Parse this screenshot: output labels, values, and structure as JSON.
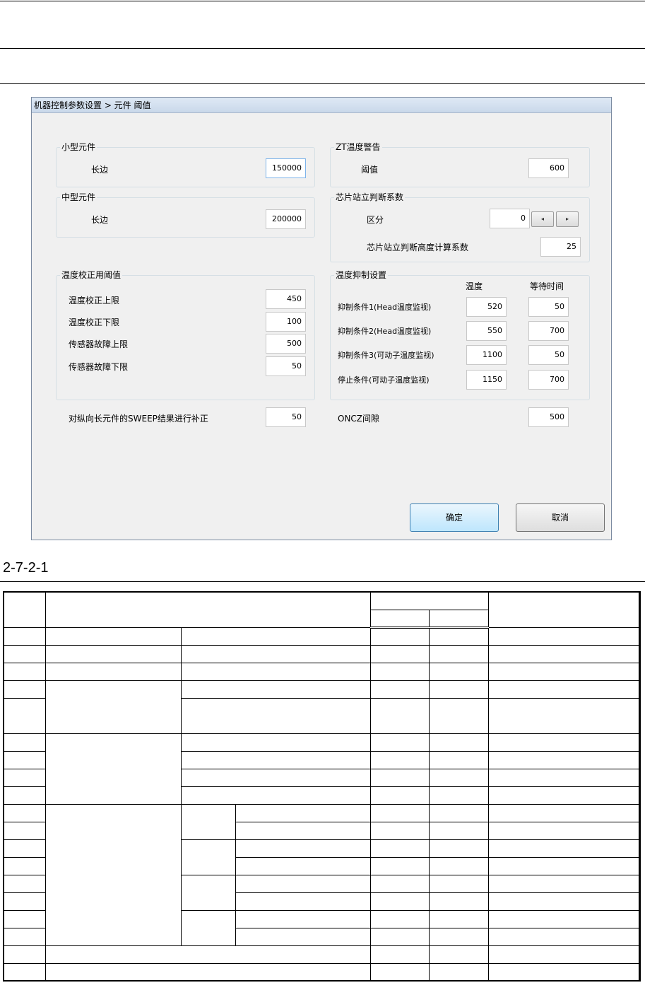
{
  "dialog": {
    "title": "机器控制参数设置 > 元件 阈值",
    "small_component": {
      "title": "小型元件",
      "long_side_label": "长边",
      "long_side_value": "150000"
    },
    "medium_component": {
      "title": "中型元件",
      "long_side_label": "长边",
      "long_side_value": "200000"
    },
    "zt_warning": {
      "title": "ZT温度警告",
      "threshold_label": "阈值",
      "threshold_value": "600"
    },
    "chip_standing": {
      "title": "芯片站立判断系数",
      "category_label": "区分",
      "category_value": "0",
      "spin_left": "◂",
      "spin_right": "▸",
      "height_coef_label": "芯片站立判断高度计算系数",
      "height_coef_value": "25"
    },
    "temp_calibration": {
      "title": "温度校正用阈值",
      "rows": [
        {
          "label": "温度校正上限",
          "value": "450"
        },
        {
          "label": "温度校正下限",
          "value": "100"
        },
        {
          "label": "传感器故障上限",
          "value": "500"
        },
        {
          "label": "传感器故障下限",
          "value": "50"
        }
      ]
    },
    "temp_suppression": {
      "title": "温度抑制设置",
      "col_temp": "温度",
      "col_wait": "等待时间",
      "rows": [
        {
          "label": "抑制条件1(Head温度监视)",
          "temp": "520",
          "wait": "50"
        },
        {
          "label": "抑制条件2(Head温度监视)",
          "temp": "550",
          "wait": "700"
        },
        {
          "label": "抑制条件3(可动子温度监视)",
          "temp": "1100",
          "wait": "50"
        },
        {
          "label": "停止条件(可动子温度监视)",
          "temp": "1150",
          "wait": "700"
        }
      ]
    },
    "sweep_label": "对纵向长元件的SWEEP结果进行补正",
    "sweep_value": "50",
    "oncz_label": "ONCZ间隙",
    "oncz_value": "500",
    "ok_button": "确定",
    "cancel_button": "取消"
  },
  "caption": "2-7-2-1"
}
